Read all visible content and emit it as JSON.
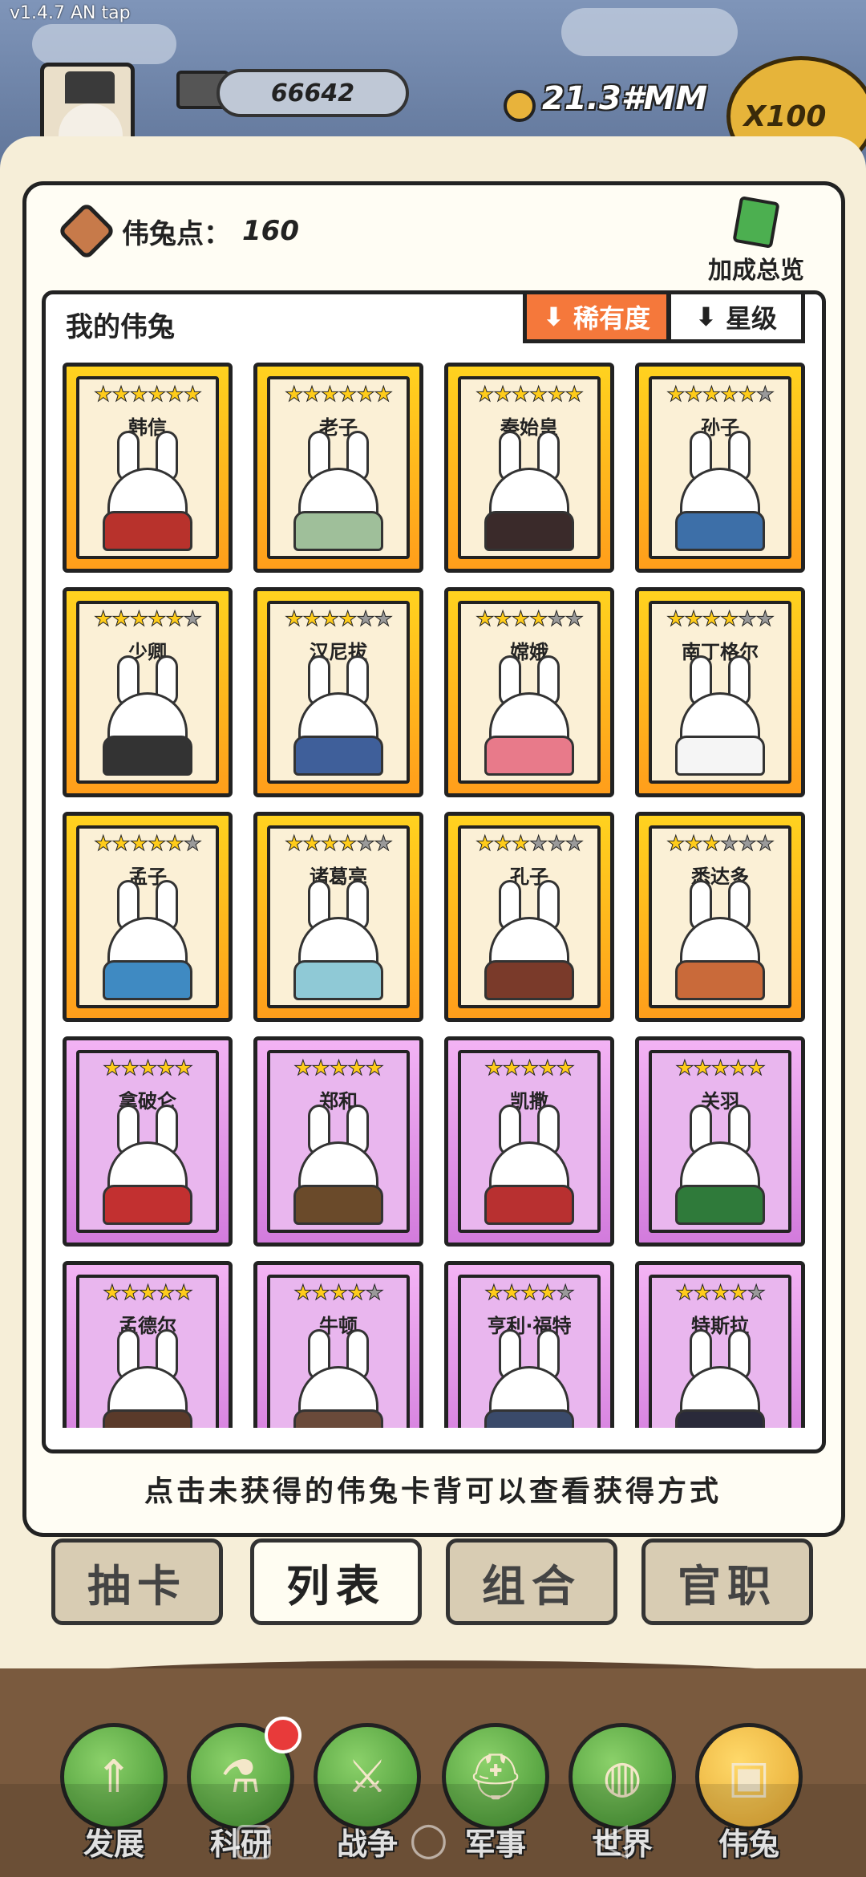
{
  "status": {
    "version": "v1.4.7 AN tap"
  },
  "top_bar": {
    "resource": "66642",
    "coin": "21.3#MM",
    "multiplier": "X100"
  },
  "panel": {
    "points_label": "伟兔点：",
    "points_value": "160",
    "bonus_label": "加成总览",
    "list_title": "我的伟兔",
    "sort_rarity": "稀有度",
    "sort_star": "星级",
    "hint": "点击未获得的伟兔卡背可以查看获得方式"
  },
  "cards": [
    {
      "name": "韩信",
      "stars": 6,
      "rarity": "gold",
      "robe": "#b8322c"
    },
    {
      "name": "老子",
      "stars": 6,
      "rarity": "gold",
      "robe": "#9fbf9a"
    },
    {
      "name": "秦始皇",
      "stars": 6,
      "rarity": "gold",
      "robe": "#3a2a2a"
    },
    {
      "name": "孙子",
      "stars": 5,
      "rarity": "gold",
      "robe": "#3d6fa8"
    },
    {
      "name": "少卿",
      "stars": 5,
      "rarity": "gold",
      "robe": "#333333"
    },
    {
      "name": "汉尼拔",
      "stars": 4,
      "rarity": "gold",
      "robe": "#3f5f9a"
    },
    {
      "name": "嫦娥",
      "stars": 4,
      "rarity": "gold",
      "robe": "#e87a8a"
    },
    {
      "name": "南丁格尔",
      "stars": 4,
      "rarity": "gold",
      "robe": "#f5f5f5"
    },
    {
      "name": "孟子",
      "stars": 5,
      "rarity": "gold",
      "robe": "#3f8ac2"
    },
    {
      "name": "诸葛亮",
      "stars": 4,
      "rarity": "gold",
      "robe": "#8fc9d6"
    },
    {
      "name": "孔子",
      "stars": 3,
      "rarity": "gold",
      "robe": "#7a3a2a"
    },
    {
      "name": "悉达多",
      "stars": 3,
      "rarity": "gold",
      "robe": "#c96a3a"
    },
    {
      "name": "拿破仑",
      "stars": 5,
      "rarity": "purple",
      "robe": "#c23030"
    },
    {
      "name": "郑和",
      "stars": 5,
      "rarity": "purple",
      "robe": "#6a4a2a"
    },
    {
      "name": "凯撒",
      "stars": 5,
      "rarity": "purple",
      "robe": "#b83030"
    },
    {
      "name": "关羽",
      "stars": 5,
      "rarity": "purple",
      "robe": "#2f7a3a"
    },
    {
      "name": "孟德尔",
      "stars": 5,
      "rarity": "purple",
      "robe": "#5a3a2a"
    },
    {
      "name": "牛顿",
      "stars": 4,
      "rarity": "purple",
      "robe": "#6a4a3a"
    },
    {
      "name": "亨利·福特",
      "stars": 4,
      "rarity": "purple",
      "robe": "#3a4a6a"
    },
    {
      "name": "特斯拉",
      "stars": 4,
      "rarity": "purple",
      "robe": "#2a2a3a"
    }
  ],
  "tabs": [
    "抽卡",
    "列表",
    "组合",
    "官职"
  ],
  "active_tab": "列表",
  "nav": [
    {
      "label": "发展",
      "icon": "arrow-up-icon",
      "glyph": "⇑"
    },
    {
      "label": "科研",
      "icon": "flask-icon",
      "glyph": "⚗"
    },
    {
      "label": "战争",
      "icon": "crossed-swords-icon",
      "glyph": "⚔"
    },
    {
      "label": "军事",
      "icon": "helmet-icon",
      "glyph": "⛑"
    },
    {
      "label": "世界",
      "icon": "globe-icon",
      "glyph": "◍"
    },
    {
      "label": "伟兔",
      "icon": "rabbit-card-icon",
      "glyph": "▣"
    }
  ],
  "colors": {
    "gold_card": "#ffb01e",
    "purple_card": "#e09be6",
    "sort_active": "#f5783b",
    "notification": "#e83a3a"
  }
}
